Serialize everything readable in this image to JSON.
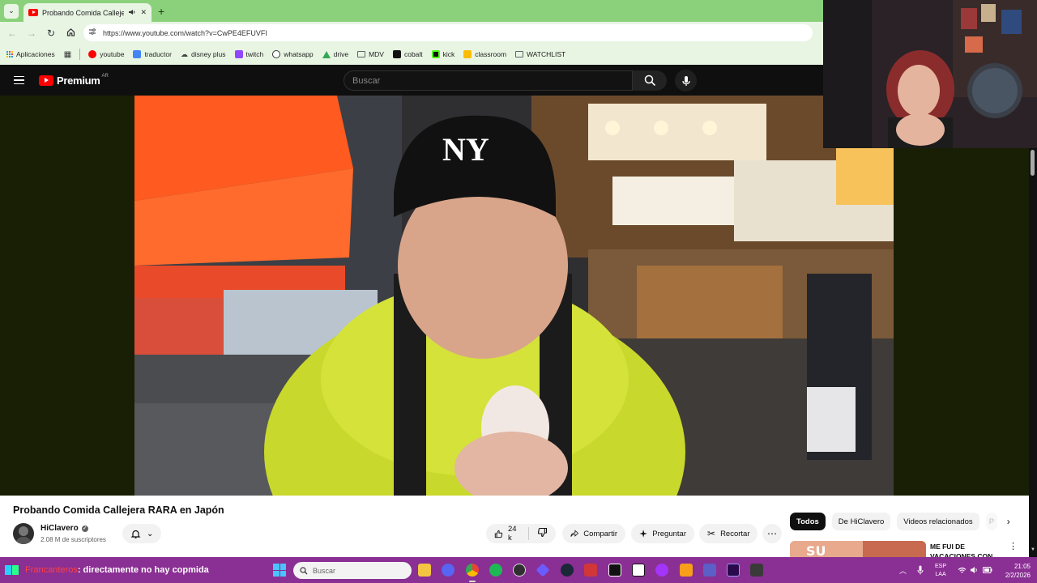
{
  "browser": {
    "tab_title": "Probando Comida Callejera",
    "url": "https://www.youtube.com/watch?v=CwPE4EFUVFI",
    "bookmarks": [
      {
        "label": "Aplicaciones",
        "icon": "apps-grid-icon",
        "color": "#4285f4"
      },
      {
        "label": "youtube",
        "icon": "youtube-icon",
        "color": "#ff0000"
      },
      {
        "label": "traductor",
        "icon": "translate-icon",
        "color": "#4285f4"
      },
      {
        "label": "disney plus",
        "icon": "disney-icon",
        "color": "#555555"
      },
      {
        "label": "twitch",
        "icon": "twitch-icon",
        "color": "#9146ff"
      },
      {
        "label": "whatsapp",
        "icon": "whatsapp-icon",
        "color": "#25d366"
      },
      {
        "label": "drive",
        "icon": "drive-icon",
        "color": "#fbbc04"
      },
      {
        "label": "MDV",
        "icon": "folder-icon",
        "color": "#5f6368"
      },
      {
        "label": "cobalt",
        "icon": "cobalt-icon",
        "color": "#111111"
      },
      {
        "label": "kick",
        "icon": "kick-icon",
        "color": "#53fc18"
      },
      {
        "label": "classroom",
        "icon": "classroom-icon",
        "color": "#fbbc04"
      },
      {
        "label": "WATCHLIST",
        "icon": "folder-icon",
        "color": "#5f6368"
      }
    ]
  },
  "youtube": {
    "logo_text": "Premium",
    "logo_country": "AR",
    "search_placeholder": "Buscar"
  },
  "video": {
    "title": "Probando Comida Callejera RARA en Japón",
    "channel": "HiClavero",
    "subscribers": "2.08 M de suscriptores",
    "likes": "24 k",
    "actions": {
      "share": "Compartir",
      "ask": "Preguntar",
      "clip": "Recortar"
    }
  },
  "sidebar": {
    "chips": [
      "Todos",
      "De HiClavero",
      "Videos relacionados",
      "P"
    ],
    "recommended_title": "ME FUI DE VACACIONES CON..."
  },
  "taskbar": {
    "chat_user": "Francanteros",
    "chat_message": ": directamente no hay copmida",
    "search_placeholder": "Buscar",
    "lang_line1": "ESP",
    "lang_line2": "LAA",
    "time": "21:05",
    "date": "2/2/2026",
    "apps": [
      {
        "name": "file-explorer-icon",
        "color": "#f4c542"
      },
      {
        "name": "discord-icon",
        "color": "#5865f2"
      },
      {
        "name": "chrome-icon",
        "color": "#4285f4"
      },
      {
        "name": "spotify-icon",
        "color": "#1db954"
      },
      {
        "name": "obs-icon",
        "color": "#302e31"
      },
      {
        "name": "streamlabs-icon",
        "color": "#6b5cff"
      },
      {
        "name": "steam-icon",
        "color": "#1b2838"
      },
      {
        "name": "riot-icon",
        "color": "#d13639"
      },
      {
        "name": "capcut-icon",
        "color": "#111111"
      },
      {
        "name": "notion-icon",
        "color": "#ffffff"
      },
      {
        "name": "messenger-icon",
        "color": "#a334fa"
      },
      {
        "name": "fl-studio-icon",
        "color": "#f79e1b"
      },
      {
        "name": "teams-icon",
        "color": "#5b5fc7"
      },
      {
        "name": "premiere-icon",
        "color": "#2a0a4a"
      },
      {
        "name": "vpn-icon",
        "color": "#3a3a3a"
      }
    ]
  }
}
